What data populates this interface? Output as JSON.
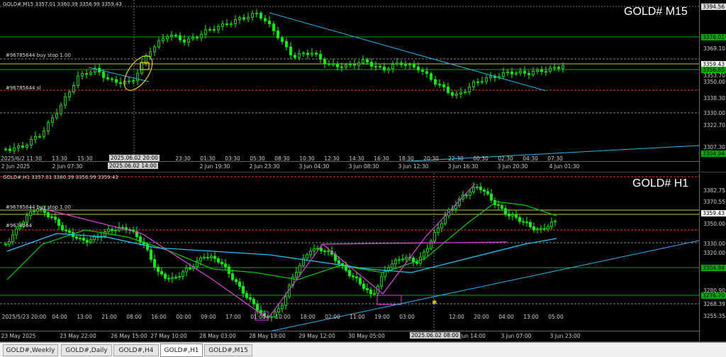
{
  "colors": {
    "bg": "#000000",
    "bull": "#00ff00",
    "bear": "#00ff00",
    "ma_fast": "#00cc00",
    "ma_slow": "#22c7ff",
    "trend": "#2bb6e8",
    "zigzag": "#e040e0",
    "highlight": "#e8d000",
    "buy_stop": "#c8c060",
    "sl": "#ff3030",
    "level_green": "#00aa00",
    "level_white": "#999999"
  },
  "m15": {
    "header": "GOLD#,M15 3357.01 3360.39 3356.99 3359.43",
    "title": "GOLD# M15",
    "buy_stop_label": "#96785644 buy stop 1.00",
    "sl_label": "#96785644 sl",
    "price_ticks": [
      "3394.56",
      "3376.01",
      "3369.10",
      "3359.43",
      "3356.65",
      "3353.70",
      "3350.00",
      "3338.30",
      "3330.00",
      "3322.70",
      "3307.30",
      "3304.94"
    ],
    "time_ticks": [
      "2 Jun 2025",
      "2 Jun 07:30",
      "2 Jun 11:30",
      "13:30",
      "15:30",
      "17:30",
      "2 Jun 15:30",
      "23:30",
      "01:30",
      "03:30",
      "05:30",
      "08:30",
      "10:30",
      "12:30",
      "14:30",
      "16:30",
      "18:30",
      "20:30",
      "22:30",
      "00:30",
      "02:30",
      "04:30",
      "07:30",
      "2 Jun 19:30",
      "2 Jun 23:30",
      "3 Jun 04:30",
      "3 Jun 08:30",
      "3 Jun 12:30",
      "3 Jun 16:30",
      "3 Jun 20:30",
      "4 Jun 01:30"
    ],
    "crosshair_time": "2025.06.02 14:00",
    "crosshair_time2": "2025.06.02 20:00",
    "crosshair_time3": "2025/6/2 11:30"
  },
  "h1": {
    "header": "GOLD#,H1 3357.01 3360.39 3356.99 3359.43",
    "title": "GOLD# H1",
    "buy_stop_label": "#96785644 buy stop 1.00",
    "sl_label": "#9678564",
    "price_ticks": [
      "3382.75",
      "3370.55",
      "3359.43",
      "3350.00",
      "3330.00",
      "3320.00",
      "3304.94",
      "3280.90",
      "3276.70",
      "3268.39",
      "3255.35"
    ],
    "time_ticks": [
      "23 May 2025",
      "23 May 22:00",
      "26 May 15:00",
      "27 May 10:00",
      "28 May 03:00",
      "28 May 19:00",
      "29 May 12:00",
      "30 May 05:00",
      "30",
      "Jun 14:00",
      "3 Jun 07:00",
      "3 Jun 23:00",
      "2025/5/23 20:00",
      "04:00",
      "13:00",
      "21:00",
      "08:00",
      "16:00",
      "00:00",
      "09:00",
      "17:00",
      "01:00",
      "10:00",
      "18:00",
      "02:00",
      "11:00",
      "19:00",
      "03:00",
      "12:00",
      "20:00",
      "04:00",
      "13:00",
      "21:00",
      "05:00"
    ],
    "crosshair_time": "2025.06.02 08:00"
  },
  "tabs": [
    "GOLD#,Weekly",
    "GOLD#,Daily",
    "GOLD#,H4",
    "GOLD#,H1",
    "GOLD#,M15"
  ],
  "active_tab": "GOLD#,H1"
}
